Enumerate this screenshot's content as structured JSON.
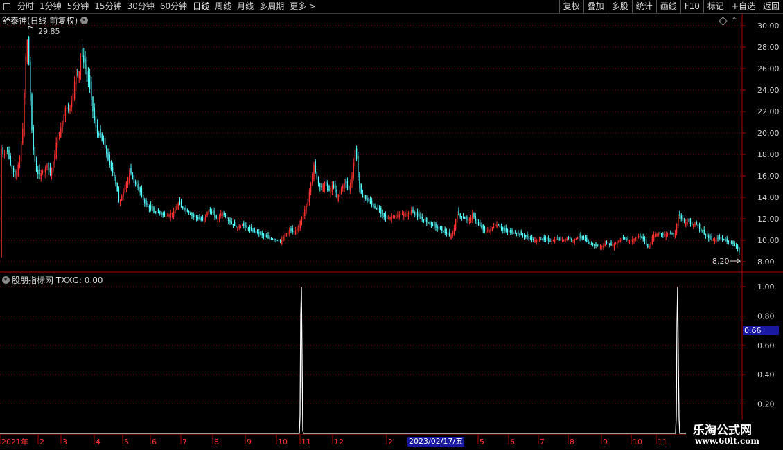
{
  "toolbar": {
    "left": [
      "分时",
      "1分钟",
      "5分钟",
      "15分钟",
      "30分钟",
      "60分钟",
      "日线",
      "周线",
      "月线",
      "多周期",
      "更多 >"
    ],
    "active": "日线",
    "right": [
      "复权",
      "叠加",
      "多股",
      "统计",
      "画线",
      "F10",
      "标记",
      "+自选",
      "返回"
    ]
  },
  "main_title": "舒泰神(日线 前复权)",
  "indicator_title": "股朋指标网  TXXG: 0.00",
  "price_axis": [
    "30.00",
    "28.00",
    "26.00",
    "24.00",
    "22.00",
    "20.00",
    "18.00",
    "16.00",
    "14.00",
    "12.00",
    "10.00",
    "8.00"
  ],
  "indicator_axis": [
    "1.00",
    "0.80",
    "0.60",
    "0.40",
    "0.20"
  ],
  "high_label": "29.85",
  "low_label": "8.20",
  "cursor_value": "0.66",
  "cursor_date": "2023/02/17/五",
  "x_axis": [
    "2021年",
    "2",
    "3",
    "4",
    "5",
    "6",
    "7",
    "8",
    "9",
    "10",
    "11",
    "12",
    "2",
    "5",
    "6",
    "7",
    "8",
    "9",
    "10",
    "11"
  ],
  "watermark": {
    "line1": "乐淘公式网",
    "line2": "www.60lt.com"
  },
  "colors": {
    "up": "#ff3232",
    "down": "#54ffff",
    "axis": "#b00000",
    "grid": "#8b0000",
    "text": "#d0d0d0"
  },
  "chart_data": {
    "type": "candlestick",
    "price_range": [
      8.0,
      30.0
    ],
    "high": 29.85,
    "low": 8.2,
    "indicator": {
      "name": "TXXG",
      "value": 0.0,
      "range": [
        0,
        1
      ],
      "spikes": [
        "2021-11",
        "2022-11"
      ],
      "spike_value": 1.0
    },
    "path": [
      [
        0,
        19.0
      ],
      [
        5,
        17.8
      ],
      [
        10,
        18.5
      ],
      [
        15,
        17.0
      ],
      [
        22,
        16.0
      ],
      [
        28,
        17.5
      ],
      [
        33,
        20.5
      ],
      [
        37,
        27.0
      ],
      [
        40,
        29.0
      ],
      [
        43,
        24.0
      ],
      [
        47,
        19.0
      ],
      [
        52,
        16.5
      ],
      [
        56,
        16.0
      ],
      [
        62,
        16.5
      ],
      [
        68,
        17.0
      ],
      [
        72,
        16.2
      ],
      [
        78,
        17.5
      ],
      [
        82,
        19.5
      ],
      [
        88,
        20.5
      ],
      [
        95,
        22.5
      ],
      [
        100,
        22.0
      ],
      [
        105,
        23.5
      ],
      [
        110,
        26.0
      ],
      [
        113,
        25.0
      ],
      [
        117,
        27.5
      ],
      [
        121,
        26.5
      ],
      [
        125,
        25.5
      ],
      [
        130,
        24.0
      ],
      [
        135,
        21.5
      ],
      [
        140,
        20.0
      ],
      [
        146,
        19.5
      ],
      [
        152,
        18.5
      ],
      [
        158,
        17.0
      ],
      [
        163,
        16.2
      ],
      [
        168,
        15.0
      ],
      [
        172,
        13.5
      ],
      [
        178,
        14.5
      ],
      [
        183,
        15.5
      ],
      [
        188,
        16.5
      ],
      [
        192,
        15.5
      ],
      [
        197,
        15.0
      ],
      [
        202,
        14.5
      ],
      [
        208,
        13.5
      ],
      [
        215,
        13.0
      ],
      [
        222,
        12.6
      ],
      [
        230,
        12.5
      ],
      [
        238,
        12.2
      ],
      [
        245,
        12.4
      ],
      [
        252,
        12.8
      ],
      [
        258,
        13.5
      ],
      [
        262,
        13.0
      ],
      [
        268,
        12.8
      ],
      [
        276,
        12.3
      ],
      [
        285,
        12.0
      ],
      [
        292,
        11.8
      ],
      [
        300,
        12.8
      ],
      [
        306,
        12.5
      ],
      [
        313,
        12.0
      ],
      [
        320,
        12.6
      ],
      [
        327,
        12.0
      ],
      [
        334,
        11.5
      ],
      [
        341,
        11.2
      ],
      [
        350,
        11.4
      ],
      [
        358,
        11.0
      ],
      [
        366,
        10.8
      ],
      [
        374,
        10.6
      ],
      [
        382,
        10.3
      ],
      [
        390,
        10.1
      ],
      [
        398,
        10.0
      ],
      [
        405,
        9.9
      ],
      [
        411,
        10.5
      ],
      [
        417,
        11.0
      ],
      [
        424,
        10.7
      ],
      [
        430,
        11.2
      ],
      [
        437,
        12.5
      ],
      [
        444,
        13.5
      ],
      [
        449,
        15.5
      ],
      [
        453,
        17.0
      ],
      [
        458,
        15.5
      ],
      [
        463,
        14.8
      ],
      [
        468,
        15.5
      ],
      [
        474,
        14.5
      ],
      [
        480,
        15.2
      ],
      [
        486,
        14.0
      ],
      [
        492,
        14.8
      ],
      [
        498,
        15.5
      ],
      [
        503,
        14.5
      ],
      [
        508,
        16.0
      ],
      [
        513,
        18.8
      ],
      [
        518,
        15.0
      ],
      [
        523,
        14.0
      ],
      [
        528,
        13.8
      ],
      [
        534,
        13.5
      ],
      [
        540,
        13.0
      ],
      [
        546,
        12.8
      ],
      [
        552,
        12.3
      ],
      [
        558,
        12.0
      ],
      [
        565,
        12.2
      ],
      [
        572,
        12.3
      ],
      [
        580,
        12.5
      ],
      [
        588,
        12.5
      ],
      [
        594,
        12.8
      ],
      [
        600,
        12.3
      ],
      [
        607,
        12.0
      ],
      [
        614,
        11.7
      ],
      [
        621,
        11.5
      ],
      [
        628,
        11.2
      ],
      [
        635,
        11.0
      ],
      [
        642,
        10.7
      ],
      [
        650,
        10.3
      ],
      [
        655,
        11.0
      ],
      [
        659,
        12.5
      ],
      [
        664,
        12.2
      ],
      [
        670,
        12.0
      ],
      [
        676,
        11.8
      ],
      [
        682,
        12.5
      ],
      [
        688,
        11.5
      ],
      [
        694,
        11.2
      ],
      [
        700,
        10.8
      ],
      [
        706,
        11.0
      ],
      [
        712,
        11.3
      ],
      [
        718,
        11.5
      ],
      [
        724,
        11.0
      ],
      [
        730,
        10.8
      ],
      [
        738,
        10.7
      ],
      [
        746,
        10.6
      ],
      [
        754,
        10.4
      ],
      [
        762,
        10.2
      ],
      [
        770,
        10.0
      ],
      [
        778,
        10.1
      ],
      [
        786,
        10.0
      ],
      [
        794,
        9.9
      ],
      [
        802,
        10.1
      ],
      [
        810,
        10.0
      ],
      [
        818,
        10.2
      ],
      [
        826,
        10.0
      ],
      [
        834,
        10.3
      ],
      [
        842,
        10.1
      ],
      [
        850,
        9.6
      ],
      [
        858,
        9.5
      ],
      [
        866,
        9.4
      ],
      [
        874,
        9.7
      ],
      [
        882,
        9.5
      ],
      [
        890,
        9.8
      ],
      [
        898,
        10.2
      ],
      [
        906,
        10.0
      ],
      [
        914,
        10.1
      ],
      [
        922,
        10.4
      ],
      [
        930,
        10.0
      ],
      [
        934,
        9.3
      ],
      [
        938,
        9.5
      ],
      [
        942,
        10.5
      ],
      [
        950,
        10.6
      ],
      [
        958,
        10.5
      ],
      [
        966,
        10.7
      ],
      [
        974,
        10.5
      ],
      [
        979,
        12.5
      ],
      [
        983,
        12.0
      ],
      [
        988,
        11.6
      ],
      [
        993,
        11.8
      ],
      [
        998,
        11.4
      ],
      [
        1004,
        11.6
      ],
      [
        1010,
        11.0
      ],
      [
        1016,
        10.6
      ],
      [
        1022,
        10.2
      ],
      [
        1028,
        10.0
      ],
      [
        1034,
        10.2
      ],
      [
        1040,
        10.1
      ],
      [
        1046,
        10.0
      ],
      [
        1052,
        9.8
      ],
      [
        1058,
        9.6
      ],
      [
        1064,
        9.3
      ],
      [
        1068,
        8.7
      ]
    ]
  }
}
